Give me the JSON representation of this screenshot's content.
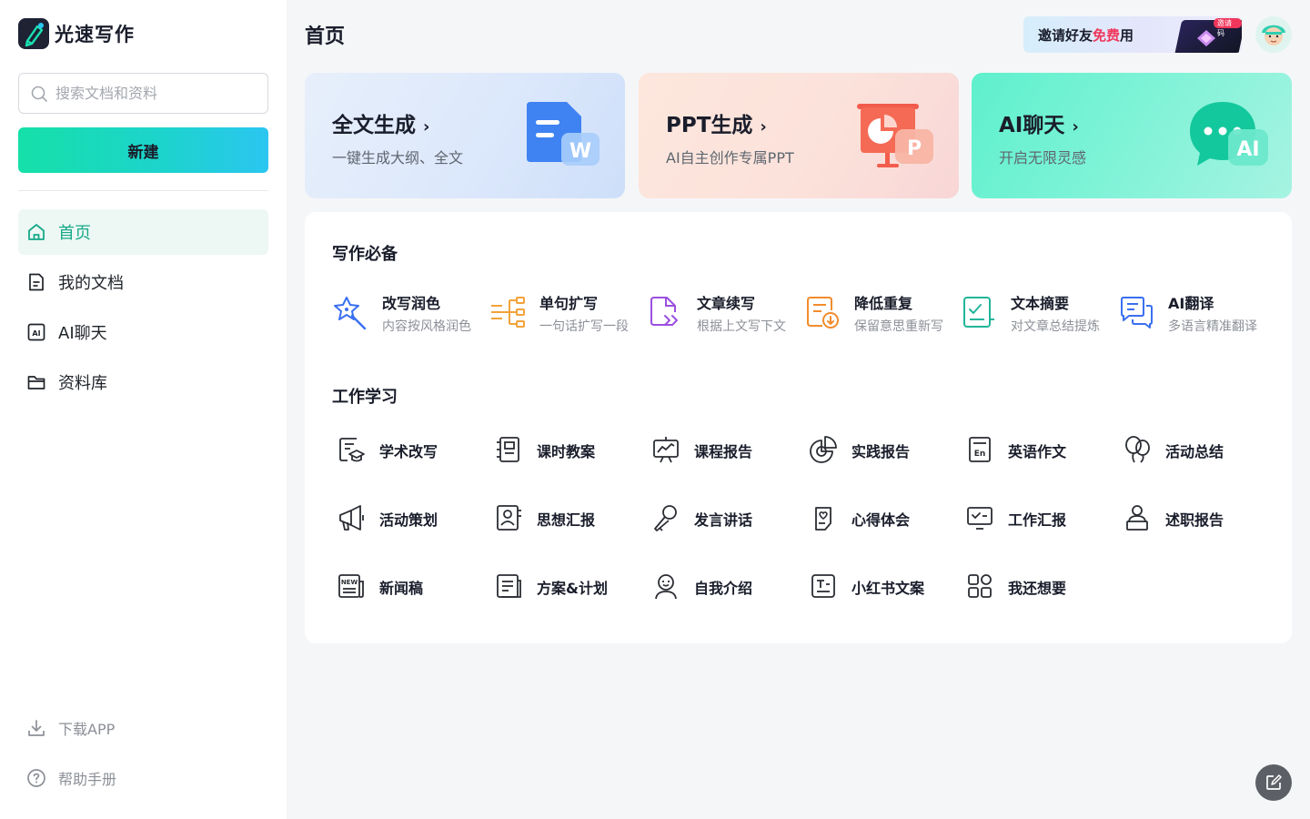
{
  "brand": {
    "name": "光速写作"
  },
  "search": {
    "placeholder": "搜索文档和资料"
  },
  "sidebar": {
    "new_label": "新建",
    "nav": [
      {
        "label": "首页",
        "icon": "home-icon",
        "active": true
      },
      {
        "label": "我的文档",
        "icon": "document-icon",
        "active": false
      },
      {
        "label": "AI聊天",
        "icon": "ai-chat-icon",
        "active": false
      },
      {
        "label": "资料库",
        "icon": "folder-icon",
        "active": false
      }
    ],
    "bottom": [
      {
        "label": "下载APP",
        "icon": "download-icon"
      },
      {
        "label": "帮助手册",
        "icon": "help-icon"
      }
    ]
  },
  "header": {
    "title": "首页",
    "invite": {
      "text_before": "邀请好友",
      "text_highlight": "免费",
      "text_after": "用",
      "tag": "邀请码"
    }
  },
  "hero_cards": [
    {
      "title": "全文生成",
      "subtitle": "一键生成大纲、全文"
    },
    {
      "title": "PPT生成",
      "subtitle": "AI自主创作专属PPT"
    },
    {
      "title": "AI聊天",
      "subtitle": "开启无限灵感"
    }
  ],
  "writing_essentials": {
    "title": "写作必备",
    "tools": [
      {
        "name": "改写润色",
        "desc": "内容按风格润色",
        "color": "#3a6ff0"
      },
      {
        "name": "单句扩写",
        "desc": "一句话扩写一段",
        "color": "#f2a33a"
      },
      {
        "name": "文章续写",
        "desc": "根据上文写下文",
        "color": "#9b4fe0"
      },
      {
        "name": "降低重复",
        "desc": "保留意思重新写",
        "color": "#f28c2c"
      },
      {
        "name": "文本摘要",
        "desc": "对文章总结提炼",
        "color": "#22b59a"
      },
      {
        "name": "AI翻译",
        "desc": "多语言精准翻译",
        "color": "#3a6ff0"
      }
    ]
  },
  "work_study": {
    "title": "工作学习",
    "items": [
      "学术改写",
      "课时教案",
      "课程报告",
      "实践报告",
      "英语作文",
      "活动总结",
      "活动策划",
      "思想汇报",
      "发言讲话",
      "心得体会",
      "工作汇报",
      "述职报告",
      "新闻稿",
      "方案&计划",
      "自我介绍",
      "小红书文案",
      "我还想要"
    ]
  }
}
